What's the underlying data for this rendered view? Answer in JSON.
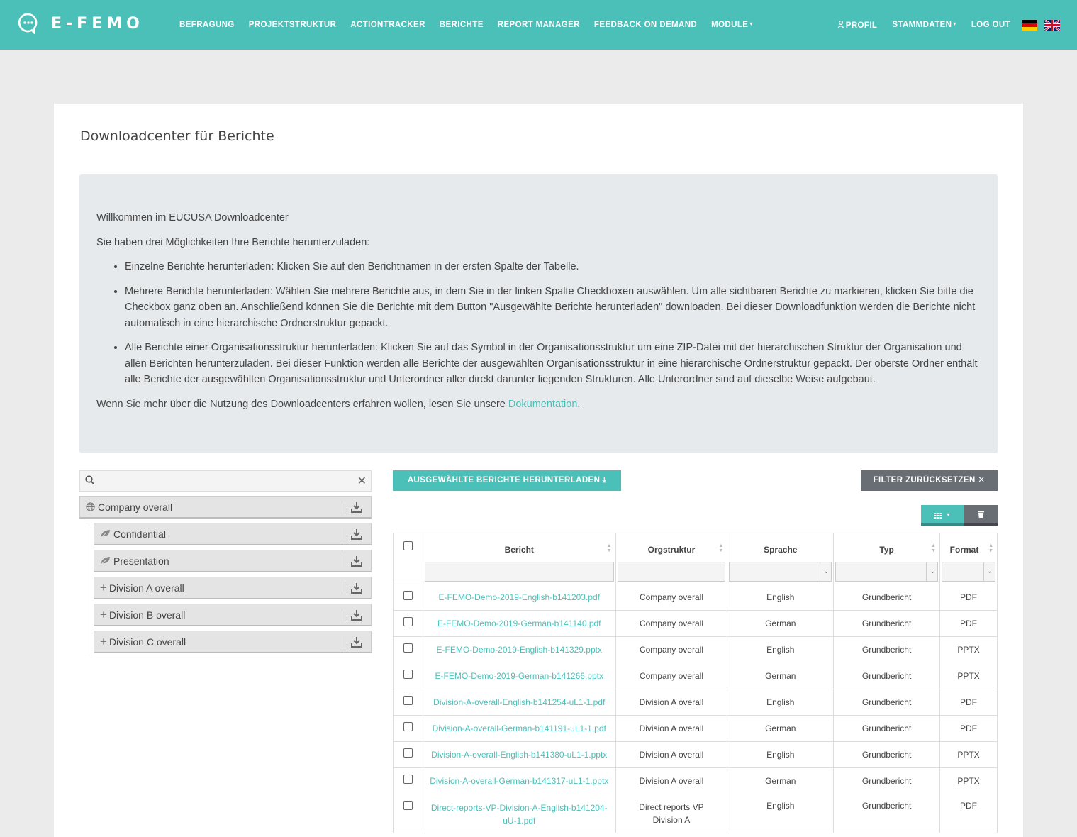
{
  "brand": {
    "name": "E-FEMO",
    "accent": "#4bc0b8"
  },
  "nav": {
    "left": [
      "BEFRAGUNG",
      "PROJEKTSTRUKTUR",
      "ACTIONTRACKER",
      "BERICHTE",
      "REPORT MANAGER",
      "FEEDBACK ON DEMAND",
      "MODULE"
    ],
    "right": {
      "profil": "PROFIL",
      "stammdaten": "STAMMDATEN",
      "logout": "LOG OUT"
    },
    "languages": [
      "de",
      "gb"
    ]
  },
  "page": {
    "title": "Downloadcenter für Berichte"
  },
  "info": {
    "welcome": "Willkommen im EUCUSA Downloadcenter",
    "intro": "Sie haben drei Möglichkeiten Ihre Berichte herunterzuladen:",
    "bullets": [
      "Einzelne Berichte herunterladen: Klicken Sie auf den Berichtnamen in der ersten Spalte der Tabelle.",
      "Mehrere Berichte herunterladen: Wählen Sie mehrere Berichte aus, in dem Sie in der linken Spalte Checkboxen auswählen. Um alle sichtbaren Berichte zu markieren, klicken Sie bitte die Checkbox ganz oben an. Anschließend können Sie die Berichte mit dem Button \"Ausgewählte Berichte herunterladen\" downloaden. Bei dieser Downloadfunktion werden die Berichte nicht automatisch in eine hierarchische Ordnerstruktur gepackt.",
      "Alle Berichte einer Organisationsstruktur herunterladen: Klicken Sie auf das Symbol in der Organisationsstruktur um eine ZIP-Datei mit der hierarchischen Struktur der Organisation und allen Berichten herunterzuladen. Bei dieser Funktion werden alle Berichte der ausgewählten Organisationsstruktur in eine hierarchische Ordnerstruktur gepackt. Der oberste Ordner enthält alle Berichte der ausgewählten Organisationsstruktur und Unterordner aller direkt darunter liegenden Strukturen. Alle Unterordner sind auf dieselbe Weise aufgebaut."
    ],
    "outro_before": "Wenn Sie mehr über die Nutzung des Downloadcenters erfahren wollen, lesen Sie unsere ",
    "outro_link": "Dokumentation",
    "outro_after": "."
  },
  "tree": {
    "search_placeholder": "",
    "root": "Company overall",
    "children": [
      "Confidential",
      "Presentation",
      "Division A overall",
      "Division B overall",
      "Division C overall"
    ]
  },
  "buttons": {
    "download_selected": "AUSGEWÄHLTE BERICHTE HERUNTERLADEN",
    "reset_filter": "FILTER ZURÜCKSETZEN"
  },
  "table": {
    "headers": [
      "Bericht",
      "Orgstruktur",
      "Sprache",
      "Typ",
      "Format"
    ],
    "rows": [
      [
        "E-FEMO-Demo-2019-English-b141203.pdf",
        "Company overall",
        "English",
        "Grundbericht",
        "PDF"
      ],
      [
        "E-FEMO-Demo-2019-German-b141140.pdf",
        "Company overall",
        "German",
        "Grundbericht",
        "PDF"
      ],
      [
        "E-FEMO-Demo-2019-English-b141329.pptx",
        "Company overall",
        "English",
        "Grundbericht",
        "PPTX"
      ],
      [
        "E-FEMO-Demo-2019-German-b141266.pptx",
        "Company overall",
        "German",
        "Grundbericht",
        "PPTX"
      ],
      [
        "Division-A-overall-English-b141254-uL1-1.pdf",
        "Division A overall",
        "English",
        "Grundbericht",
        "PDF"
      ],
      [
        "Division-A-overall-German-b141191-uL1-1.pdf",
        "Division A overall",
        "German",
        "Grundbericht",
        "PDF"
      ],
      [
        "Division-A-overall-English-b141380-uL1-1.pptx",
        "Division A overall",
        "English",
        "Grundbericht",
        "PPTX"
      ],
      [
        "Division-A-overall-German-b141317-uL1-1.pptx",
        "Division A overall",
        "German",
        "Grundbericht",
        "PPTX"
      ],
      [
        "Direct-reports-VP-Division-A-English-b141204-uU-1.pdf",
        "Direct reports VP Division A",
        "English",
        "Grundbericht",
        "PDF"
      ]
    ]
  }
}
